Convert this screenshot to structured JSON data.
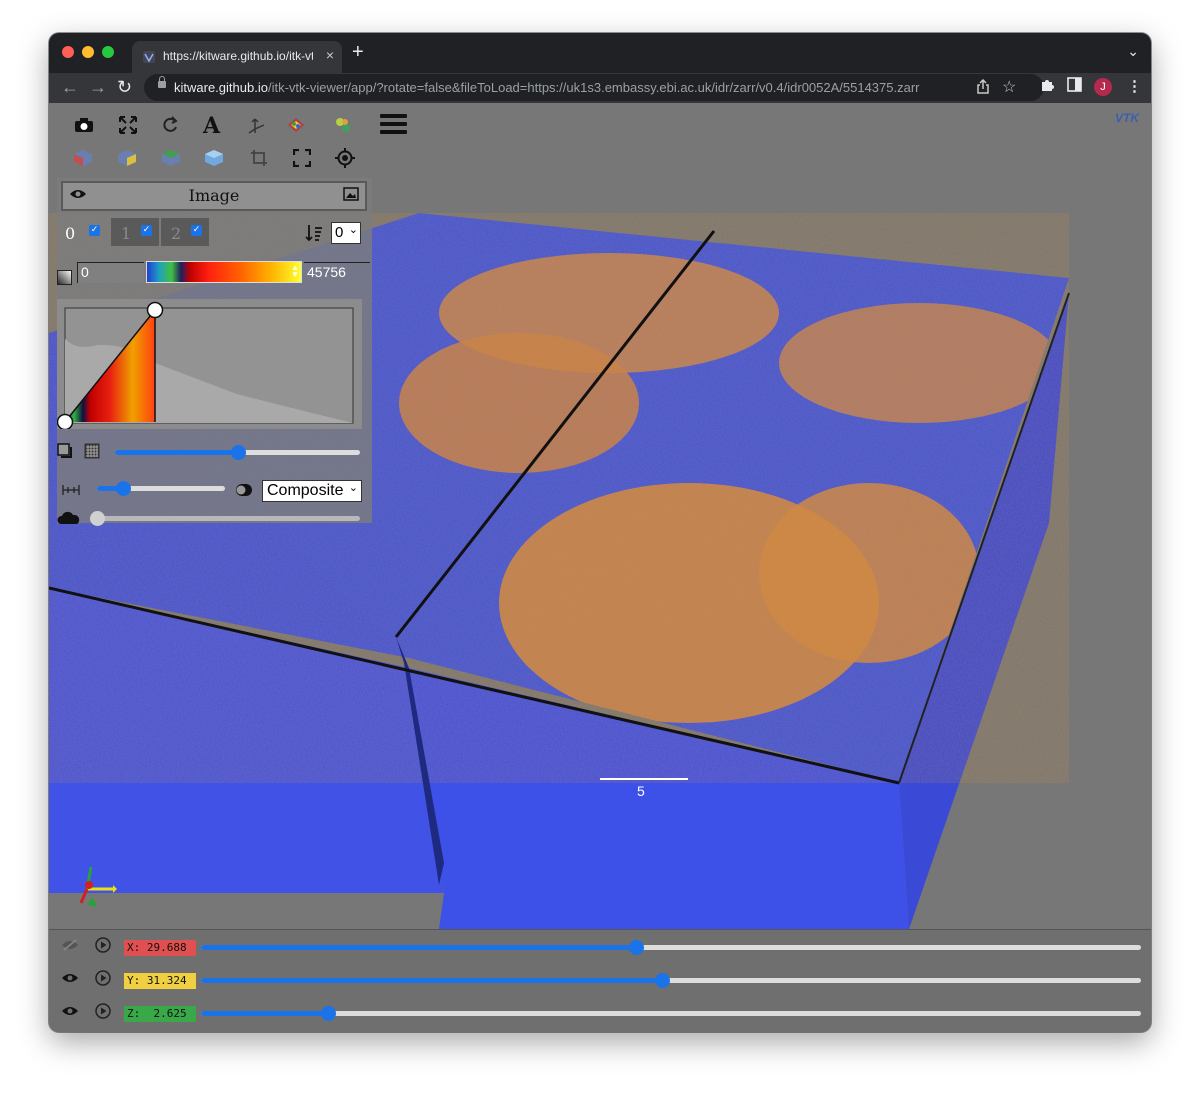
{
  "browser": {
    "tab_title": "https://kitware.github.io/itk-vtk",
    "tab_close": "×",
    "new_tab": "+",
    "url_host": "kitware.github.io",
    "url_path": "/itk-vtk-viewer/app/?rotate=false&fileToLoad=https://uk1s3.embassy.ebi.ac.uk/idr/zarr/v0.4/idr0052A/5514375.zarr",
    "profile_initial": "J"
  },
  "colors": {
    "traffic_red": "#ff5f57",
    "traffic_yellow": "#febc2e",
    "traffic_green": "#28c840",
    "accent": "#1a73e8",
    "x_badge": "#e05050",
    "y_badge": "#f0d040",
    "z_badge": "#38a848",
    "volume_blue": "#3a4ee0",
    "volume_orange": "#e89030"
  },
  "viewer": {
    "logo": "VTK",
    "image_label": "Image",
    "channels": [
      "0",
      "1",
      "2"
    ],
    "component_select": "0",
    "range_min": "0",
    "range_max": "45756",
    "blend_mode": "Composite",
    "gradient_opacity": 0.5,
    "sample_distance": 0.2,
    "shadow": 0.0,
    "scale_bar_label": "5"
  },
  "slices": [
    {
      "label": "X: 29.688",
      "value": 0.463
    },
    {
      "label": "Y: 31.324",
      "value": 0.49
    },
    {
      "label": "Z:  2.625",
      "value": 0.135
    }
  ]
}
